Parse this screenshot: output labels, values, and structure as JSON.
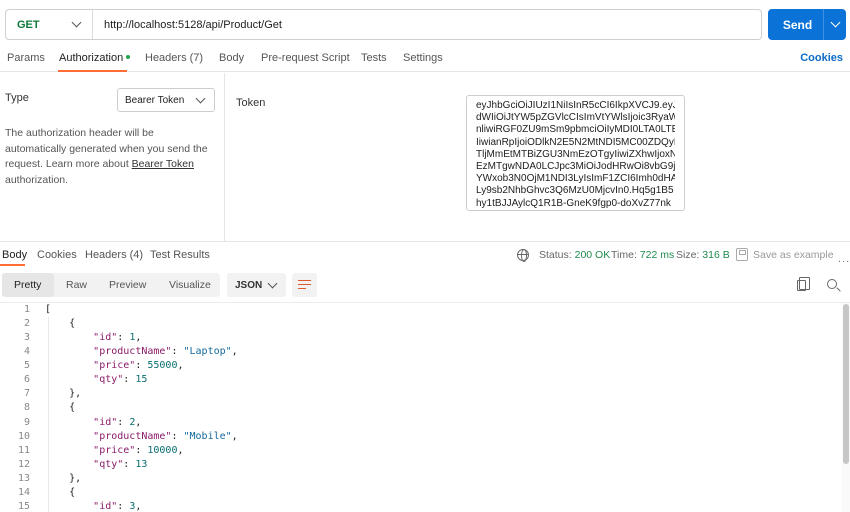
{
  "request": {
    "method": "GET",
    "url": "http://localhost:5128/api/Product/Get",
    "send_label": "Send"
  },
  "request_tabs": [
    {
      "label": "Params"
    },
    {
      "label": "Authorization"
    },
    {
      "label": "Headers (7)"
    },
    {
      "label": "Body"
    },
    {
      "label": "Pre-request Script"
    },
    {
      "label": "Tests"
    },
    {
      "label": "Settings"
    }
  ],
  "cookies_label": "Cookies",
  "auth": {
    "type_label": "Type",
    "type_value": "Bearer Token",
    "help_prefix": "The authorization header will be automatically generated when you send the request. Learn more about ",
    "help_link": "Bearer Token",
    "help_suffix": " authorization.",
    "token_label": "Token",
    "token_lines": [
      "eyJhbGciOiJIUzI1NiIsInR5cCI6IkpXVCJ9.eyJz",
      "dWIiOiJtYW5pZGVlcCIsImVtYWlsIjoic3RyaW5",
      "nliwiRGF0ZU9mSm9pbmciOiIyMDI0LTA0LTE1",
      "IiwianRpIjoiODlkN2E5N2MtNDI5MC00ZDQyL",
      "TljMmEtMTBiZGU3NmEzOTgyIiwiZXhwIjoxNz",
      "EzMTgwNDA0LCJpc3MiOiJodHRwOi8vbG9j",
      "YWxob3N0OjM1NDI3LyIsImF1ZCI6Imh0dHA6",
      "Ly9sb2NhbGhvc3Q6MzU0MjcvIn0.Hq5g1B5",
      "hy1tBJJAylcQ1R1B-GneK9fgp0-doXvZ77nk"
    ]
  },
  "response_tabs": [
    {
      "label": "Body"
    },
    {
      "label": "Cookies"
    },
    {
      "label": "Headers (4)"
    },
    {
      "label": "Test Results"
    }
  ],
  "status": {
    "status_label": "Status:",
    "status_value": "200 OK",
    "time_label": "Time:",
    "time_value": "722 ms",
    "size_label": "Size:",
    "size_value": "316 B",
    "save_label": "Save as example",
    "more": "..."
  },
  "view_modes": [
    "Pretty",
    "Raw",
    "Preview",
    "Visualize"
  ],
  "format": "JSON",
  "response_json": [
    {
      "id": 1,
      "productName": "Laptop",
      "price": 55000,
      "qty": 15
    },
    {
      "id": 2,
      "productName": "Mobile",
      "price": 10000,
      "qty": 13
    },
    {
      "id": 3
    }
  ],
  "code_lines": [
    {
      "n": "1",
      "t": "["
    },
    {
      "n": "2",
      "t": "    {"
    },
    {
      "n": "3",
      "t": "        \"id\": 1,"
    },
    {
      "n": "4",
      "t": "        \"productName\": \"Laptop\","
    },
    {
      "n": "5",
      "t": "        \"price\": 55000,"
    },
    {
      "n": "6",
      "t": "        \"qty\": 15"
    },
    {
      "n": "7",
      "t": "    },"
    },
    {
      "n": "8",
      "t": "    {"
    },
    {
      "n": "9",
      "t": "        \"id\": 2,"
    },
    {
      "n": "10",
      "t": "        \"productName\": \"Mobile\","
    },
    {
      "n": "11",
      "t": "        \"price\": 10000,"
    },
    {
      "n": "12",
      "t": "        \"qty\": 13"
    },
    {
      "n": "13",
      "t": "    },"
    },
    {
      "n": "14",
      "t": "    {"
    },
    {
      "n": "15",
      "t": "        \"id\": 3,"
    }
  ]
}
